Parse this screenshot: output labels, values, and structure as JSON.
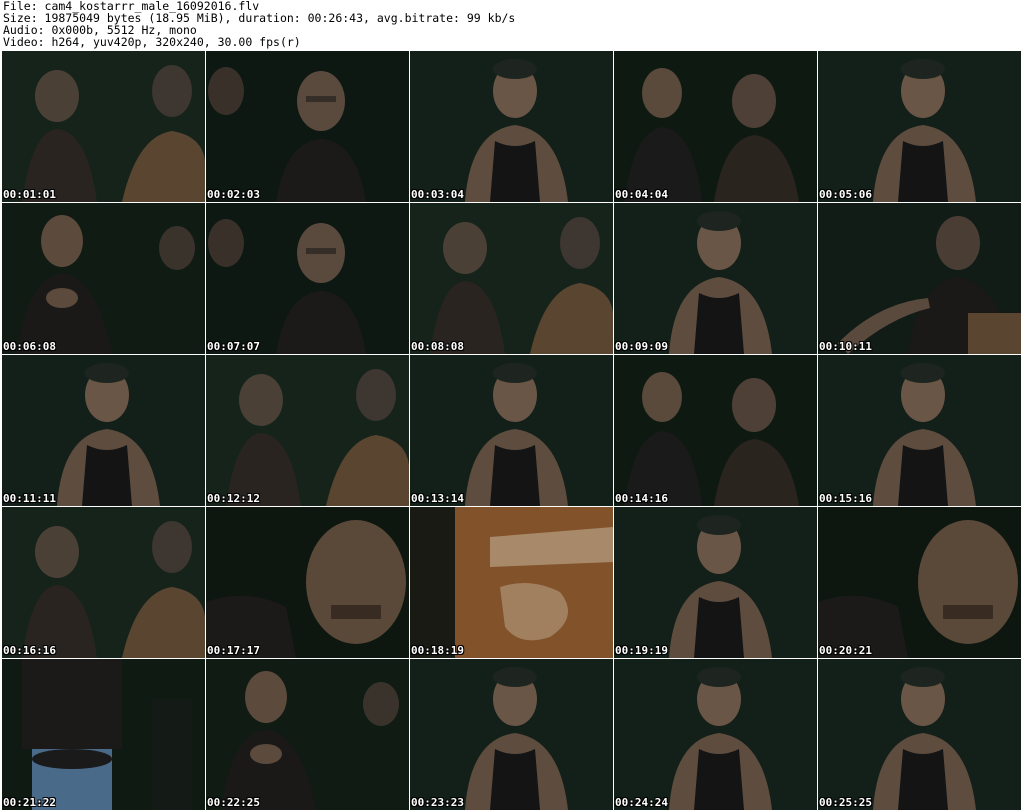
{
  "header": {
    "line1": "File: cam4_kostarrr_male_16092016.flv",
    "line2": "Size: 19875049 bytes (18.95 MiB), duration: 00:26:43, avg.bitrate: 99 kb/s",
    "line3": "Audio: 0x000b, 5512 Hz, mono",
    "line4": "Video: h264, yuv420p, 320x240, 30.00 fps(r)"
  },
  "thumbnails": [
    {
      "time": "00:01:01",
      "scene": "two-people-dark"
    },
    {
      "time": "00:02:03",
      "scene": "man-glasses"
    },
    {
      "time": "00:03:04",
      "scene": "man-tank-top"
    },
    {
      "time": "00:04:04",
      "scene": "two-people-laughing"
    },
    {
      "time": "00:05:06",
      "scene": "man-tank-top"
    },
    {
      "time": "00:06:08",
      "scene": "man-seated"
    },
    {
      "time": "00:07:07",
      "scene": "man-glasses"
    },
    {
      "time": "00:08:08",
      "scene": "two-people-dark"
    },
    {
      "time": "00:09:09",
      "scene": "man-tank-top"
    },
    {
      "time": "00:10:11",
      "scene": "man-reaching"
    },
    {
      "time": "00:11:11",
      "scene": "man-tank-top"
    },
    {
      "time": "00:12:12",
      "scene": "two-people-dark"
    },
    {
      "time": "00:13:14",
      "scene": "man-tank-top"
    },
    {
      "time": "00:14:16",
      "scene": "two-people-laughing"
    },
    {
      "time": "00:15:16",
      "scene": "man-tank-top"
    },
    {
      "time": "00:16:16",
      "scene": "two-people-dark"
    },
    {
      "time": "00:17:17",
      "scene": "close-face"
    },
    {
      "time": "00:18:19",
      "scene": "shirt-closeup"
    },
    {
      "time": "00:19:19",
      "scene": "man-tank-top"
    },
    {
      "time": "00:20:21",
      "scene": "close-face"
    },
    {
      "time": "00:21:22",
      "scene": "person-standing"
    },
    {
      "time": "00:22:25",
      "scene": "man-seated"
    },
    {
      "time": "00:23:23",
      "scene": "man-tank-top"
    },
    {
      "time": "00:24:24",
      "scene": "man-tank-top"
    },
    {
      "time": "00:25:25",
      "scene": "man-tank-top"
    }
  ]
}
